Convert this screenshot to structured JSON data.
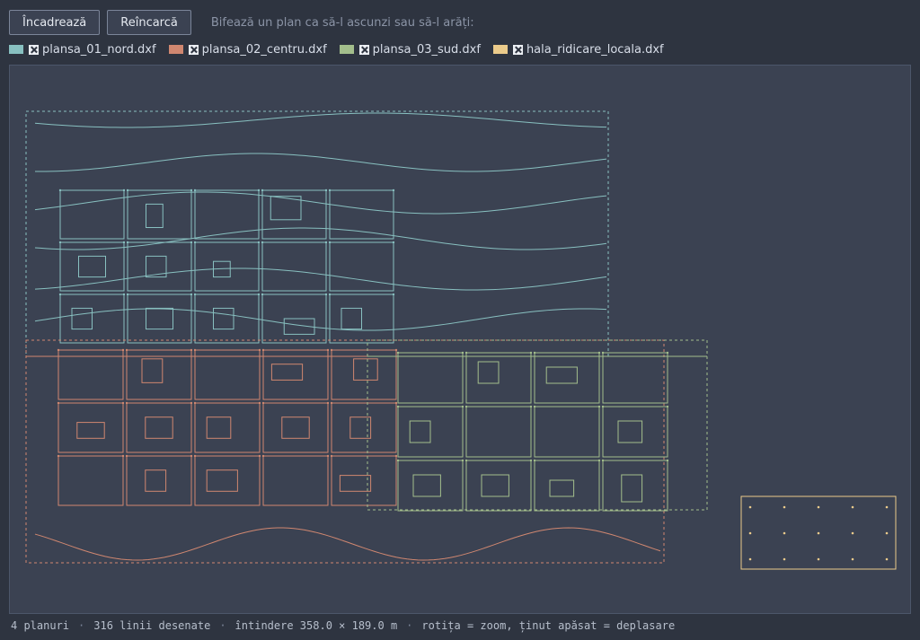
{
  "toolbar": {
    "fit_label": "Încadrează",
    "reload_label": "Reîncarcă",
    "hint": "Bifează un plan ca să-l ascunzi sau să-l arăți:"
  },
  "layers": [
    {
      "name": "plansa_01_nord.dxf",
      "color": "#88c0c0",
      "checked": true
    },
    {
      "name": "plansa_02_centru.dxf",
      "color": "#d08770",
      "checked": true
    },
    {
      "name": "plansa_03_sud.dxf",
      "color": "#a3be8c",
      "checked": true
    },
    {
      "name": "hala_ridicare_locala.dxf",
      "color": "#ebcb8b",
      "checked": true
    }
  ],
  "status": {
    "layers": "4 planuri",
    "lines": "316 linii desenate",
    "extent": "întindere 358.0 × 189.0 m",
    "controls": "rotița = zoom, ținut apăsat = deplasare"
  }
}
